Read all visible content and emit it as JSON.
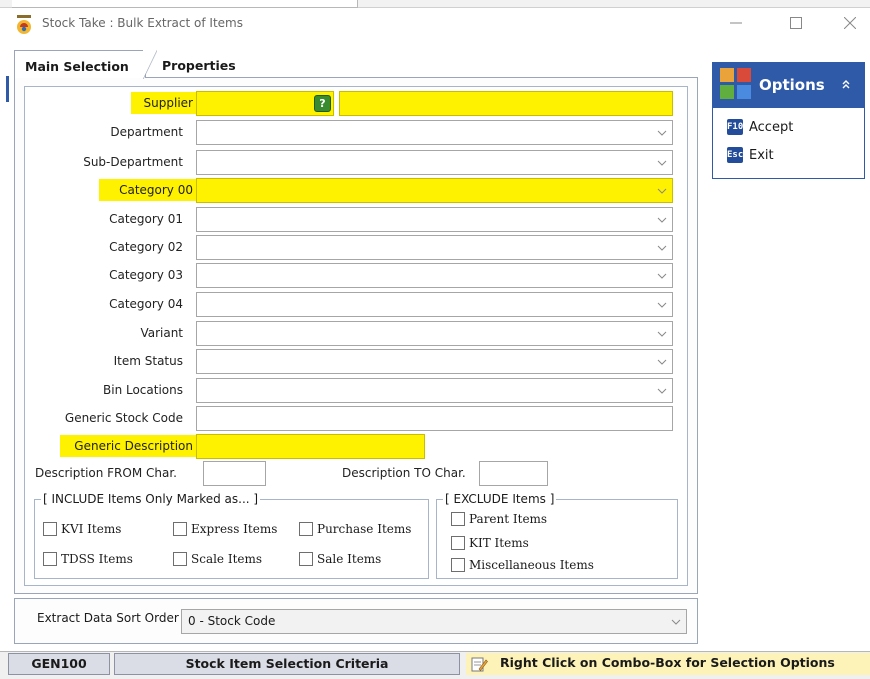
{
  "window": {
    "title": "Stock Take : Bulk Extract of Items",
    "minimize_icon": "minimize-icon",
    "maximize_icon": "maximize-icon",
    "close_icon": "close-icon"
  },
  "tabs": [
    {
      "label": "Main Selection",
      "active": true
    },
    {
      "label": "Properties",
      "active": false
    }
  ],
  "fields": {
    "supplier": {
      "label": "Supplier",
      "code_value": "",
      "name_value": "",
      "lookup_icon": "question-lookup-icon"
    },
    "department": {
      "label": "Department",
      "value": ""
    },
    "sub_department": {
      "label": "Sub-Department",
      "value": ""
    },
    "category_00": {
      "label": "Category 00",
      "value": ""
    },
    "category_01": {
      "label": "Category 01",
      "value": ""
    },
    "category_02": {
      "label": "Category 02",
      "value": ""
    },
    "category_03": {
      "label": "Category 03",
      "value": ""
    },
    "category_04": {
      "label": "Category 04",
      "value": ""
    },
    "variant": {
      "label": "Variant",
      "value": ""
    },
    "item_status": {
      "label": "Item Status",
      "value": ""
    },
    "bin_locations": {
      "label": "Bin Locations",
      "value": ""
    },
    "generic_stock_code": {
      "label": "Generic Stock Code",
      "value": ""
    },
    "generic_description": {
      "label": "Generic Description",
      "value": ""
    },
    "description_from": {
      "label": "Description FROM Char.",
      "value": ""
    },
    "description_to": {
      "label": "Description TO Char.",
      "value": ""
    }
  },
  "include_group": {
    "legend": "[ INCLUDE Items Only Marked as... ]",
    "items": [
      {
        "label": "KVI Items",
        "checked": false
      },
      {
        "label": "Express Items",
        "checked": false
      },
      {
        "label": "Purchase Items",
        "checked": false
      },
      {
        "label": "TDSS Items",
        "checked": false
      },
      {
        "label": "Scale Items",
        "checked": false
      },
      {
        "label": "Sale Items",
        "checked": false
      }
    ]
  },
  "exclude_group": {
    "legend": "[ EXCLUDE Items ]",
    "items": [
      {
        "label": "Parent Items",
        "checked": false
      },
      {
        "label": "KIT Items",
        "checked": false
      },
      {
        "label": "Miscellaneous Items",
        "checked": false
      }
    ]
  },
  "sort": {
    "label": "Extract Data Sort Order",
    "value": "0 - Stock Code"
  },
  "status_bar": {
    "code": "GEN100",
    "section": "Stock Item Selection Criteria",
    "hint": "Right Click on Combo-Box for Selection Options"
  },
  "options_panel": {
    "title": "Options",
    "items": [
      {
        "key": "F10",
        "label": "Accept"
      },
      {
        "key": "Esc",
        "label": "Exit"
      }
    ]
  },
  "colors": {
    "highlight": "#fff200",
    "accent": "#2f5aa8",
    "hint_background": "#fdf3b8"
  }
}
